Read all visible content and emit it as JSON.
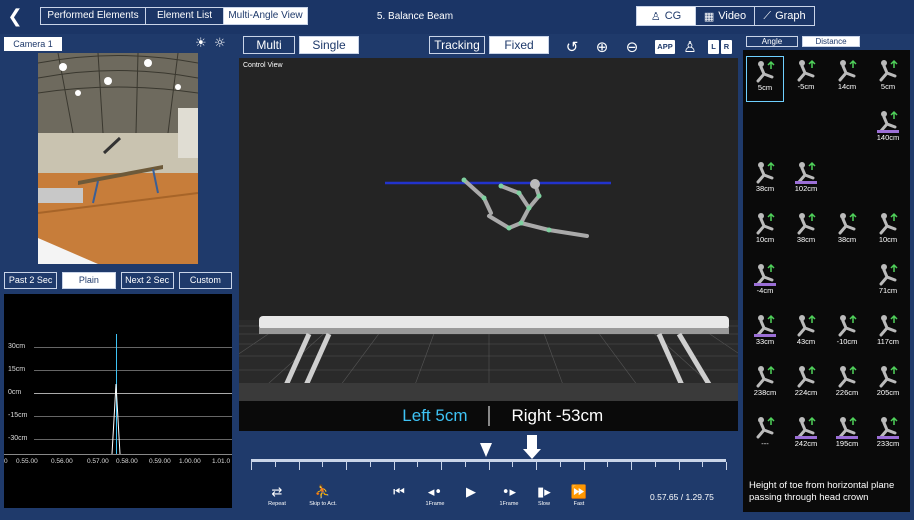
{
  "header": {
    "tabs": [
      {
        "label": "Performed Elements",
        "active": false
      },
      {
        "label": "Element List",
        "active": false
      },
      {
        "label": "Multi-Angle View",
        "active": true
      }
    ],
    "title": "5. Balance Beam",
    "views": [
      {
        "label": "CG",
        "icon": "person-icon",
        "active": true
      },
      {
        "label": "Video",
        "icon": "film-icon",
        "active": false
      },
      {
        "label": "Graph",
        "icon": "graph-icon",
        "active": false
      }
    ]
  },
  "left": {
    "camera_label": "Camera 1",
    "nav_buttons": [
      {
        "label": "Past 2 Sec",
        "active": false
      },
      {
        "label": "Plain",
        "active": true
      },
      {
        "label": "Next 2 Sec",
        "active": false
      },
      {
        "label": "Custom",
        "active": false
      }
    ],
    "graph": {
      "y_labels": [
        "30cm",
        "15cm",
        "0cm",
        "-15cm",
        "-30cm"
      ],
      "x_labels": [
        "0",
        "0.55.00",
        "0.56.00",
        "0.57.00",
        "0.58.00",
        "0.59.00",
        "1.00.00",
        "1.01.0"
      ]
    }
  },
  "center": {
    "mode_buttons": [
      {
        "label": "Multi",
        "active": false
      },
      {
        "label": "Single",
        "active": true
      }
    ],
    "tracking_buttons": [
      {
        "label": "Tracking",
        "active": false
      },
      {
        "label": "Fixed",
        "active": true
      }
    ],
    "badges": {
      "app": "APP",
      "left": "L",
      "right": "R"
    },
    "viewport_label": "Control View",
    "readout_left": "Left 5cm",
    "readout_right": "Right -53cm",
    "progress": 0.45,
    "controls": [
      {
        "icon": "repeat-icon",
        "label": "Repeat"
      },
      {
        "icon": "skip-to-act-icon",
        "label": "Skip to Act."
      },
      {
        "icon": "skip-back-icon",
        "label": ""
      },
      {
        "icon": "frame-back-icon",
        "label": "1Frame"
      },
      {
        "icon": "play-icon",
        "label": ""
      },
      {
        "icon": "frame-forward-icon",
        "label": "1Frame"
      },
      {
        "icon": "slow-icon",
        "label": "Slow"
      },
      {
        "icon": "fast-icon",
        "label": "Fast"
      }
    ],
    "timecode": "0.57.65 / 1.29.75"
  },
  "right": {
    "tabs": [
      {
        "label": "Angle",
        "active": false
      },
      {
        "label": "Distance",
        "active": true
      }
    ],
    "elements": [
      {
        "value": "5cm",
        "selected": true
      },
      {
        "value": "-5cm"
      },
      {
        "value": "14cm"
      },
      {
        "value": "5cm"
      },
      {
        "value": "140cm"
      },
      {
        "value": "38cm"
      },
      {
        "value": "102cm"
      },
      {
        "value": "10cm"
      },
      {
        "value": "38cm"
      },
      {
        "value": "38cm"
      },
      {
        "value": "10cm"
      },
      {
        "value": "-4cm"
      },
      {
        "value": "71cm"
      },
      {
        "value": "33cm"
      },
      {
        "value": "43cm"
      },
      {
        "value": "-10cm"
      },
      {
        "value": "117cm"
      },
      {
        "value": "238cm"
      },
      {
        "value": "224cm"
      },
      {
        "value": "226cm"
      },
      {
        "value": "205cm"
      },
      {
        "value": "---"
      },
      {
        "value": "242cm"
      },
      {
        "value": "195cm"
      },
      {
        "value": "233cm"
      }
    ],
    "description": "Height of toe from horizontal plane passing through head crown"
  },
  "colors": {
    "accent": "#3ec3f5",
    "panel": "#1f3a6b",
    "highlight": "#9b6fd6"
  }
}
